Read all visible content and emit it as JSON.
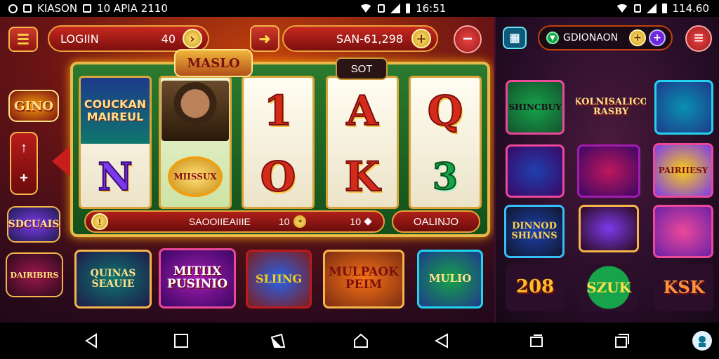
{
  "status_left": {
    "text": "KIASON",
    "date": "10 APIA 2110"
  },
  "status_right": {
    "time_mid": "16:51",
    "time_right": "114.60"
  },
  "header": {
    "left_button": "☰",
    "login_label": "LOGIIN",
    "login_amount": "40",
    "balance_label": "SAN-61,298",
    "profile_label": "GDIONAON"
  },
  "reels": {
    "title_badge": "MASLO",
    "slot_tab": "SOT",
    "reel1": {
      "top": "COUCKAN MAIREUL",
      "bottom": "N"
    },
    "reel2": {
      "bottom": "MIISSUX"
    },
    "reel3": {
      "top": "1",
      "bottom": "O"
    },
    "reel4": {
      "top": "A",
      "bottom": "K"
    },
    "reel5": {
      "top": "Q",
      "bottom": "3"
    }
  },
  "bottom_bar": {
    "label": "SAOOIIEAIIIE",
    "value1": "10",
    "value2": "10",
    "spin": "OALINJO"
  },
  "side": {
    "logo1": "GINO",
    "logo2": "SDCUAIS",
    "logo3": "DAIRIBIRS"
  },
  "tiles_bottom": [
    "QUINAS SEAUIE",
    "MITIIX PUSINIO",
    "SLIING",
    "MULPAOK PEIM",
    "MULIO"
  ],
  "tiles_right": [
    [
      "SHINCBUY",
      "KOLNISALICO RASBY",
      ""
    ],
    [
      "",
      "",
      "PAIRIIESY"
    ],
    [
      "DINNOD SHIAINS",
      "",
      ""
    ],
    [
      "208",
      "SZUK",
      "KSK"
    ]
  ],
  "nav": [
    "back",
    "home",
    "recents"
  ],
  "colors": {
    "accent": "#e9a23b",
    "primary": "#c8281f",
    "green": "#2b7a2e"
  }
}
